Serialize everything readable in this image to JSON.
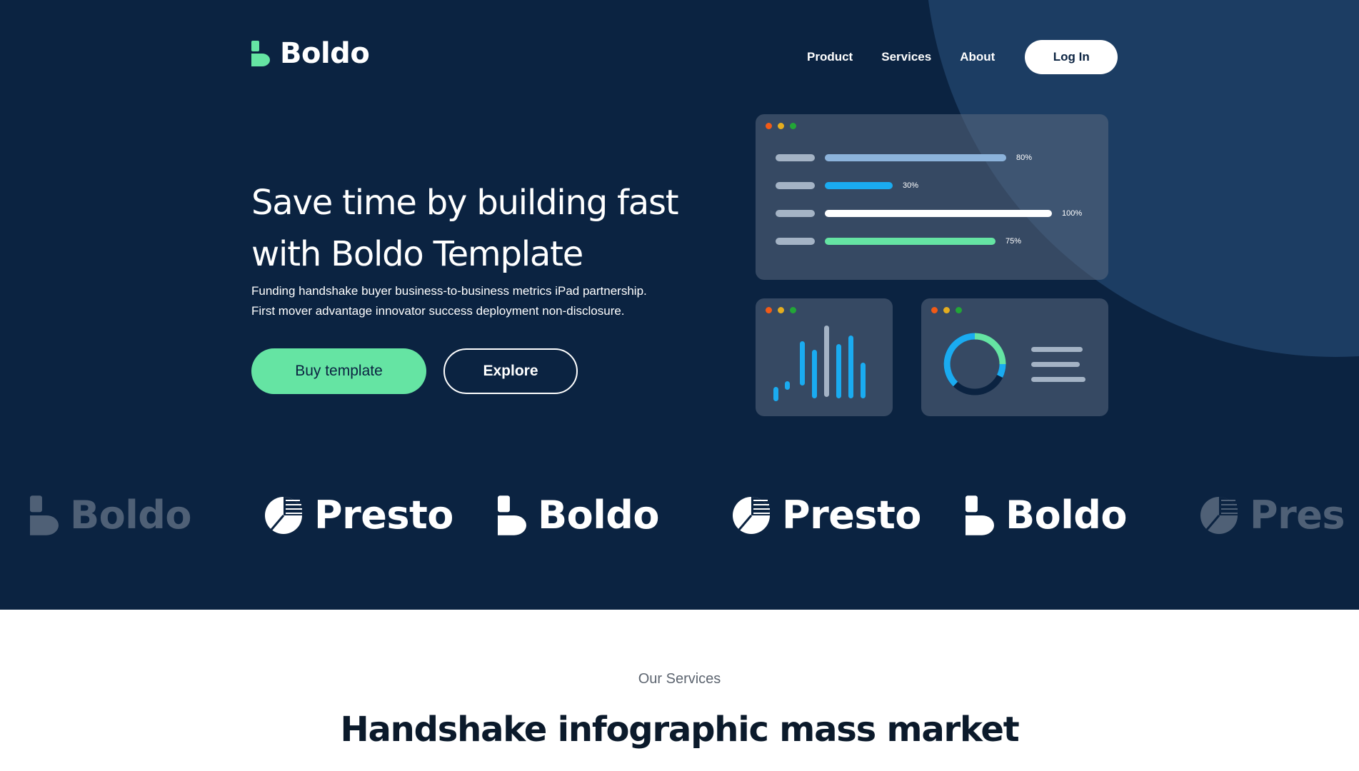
{
  "brand": {
    "name": "Boldo",
    "accent": "#65e4a3",
    "bg": "#0b2341"
  },
  "nav": {
    "links": [
      {
        "label": "Product"
      },
      {
        "label": "Services"
      },
      {
        "label": "About"
      }
    ],
    "login_label": "Log In"
  },
  "hero": {
    "title": "Save time by building fast with Boldo Template",
    "subtitle_line1": "Funding handshake buyer business-to-business metrics iPad partnership.",
    "subtitle_line2": "First mover advantage innovator success deployment non-disclosure.",
    "primary_button": "Buy template",
    "secondary_button": "Explore"
  },
  "dashboard": {
    "progress": [
      {
        "value": 80,
        "label": "80%",
        "color": "#8cb3db"
      },
      {
        "value": 30,
        "label": "30%",
        "color": "#1aabf0"
      },
      {
        "value": 100,
        "label": "100%",
        "color": "#ffffff"
      },
      {
        "value": 75,
        "label": "75%",
        "color": "#65e4a3"
      }
    ],
    "donut": {
      "colors": [
        "#65e4a3",
        "#1aabf0",
        "#0b2341"
      ]
    }
  },
  "logos": [
    {
      "name": "Boldo",
      "icon": "boldo-logo-icon"
    },
    {
      "name": "Presto",
      "icon": "presto-logo-icon"
    },
    {
      "name": "Boldo",
      "icon": "boldo-logo-icon"
    },
    {
      "name": "Presto",
      "icon": "presto-logo-icon"
    },
    {
      "name": "Boldo",
      "icon": "boldo-logo-icon"
    },
    {
      "name": "Pres",
      "icon": "presto-logo-icon"
    }
  ],
  "services": {
    "eyebrow": "Our Services",
    "title": "Handshake infographic mass market"
  }
}
